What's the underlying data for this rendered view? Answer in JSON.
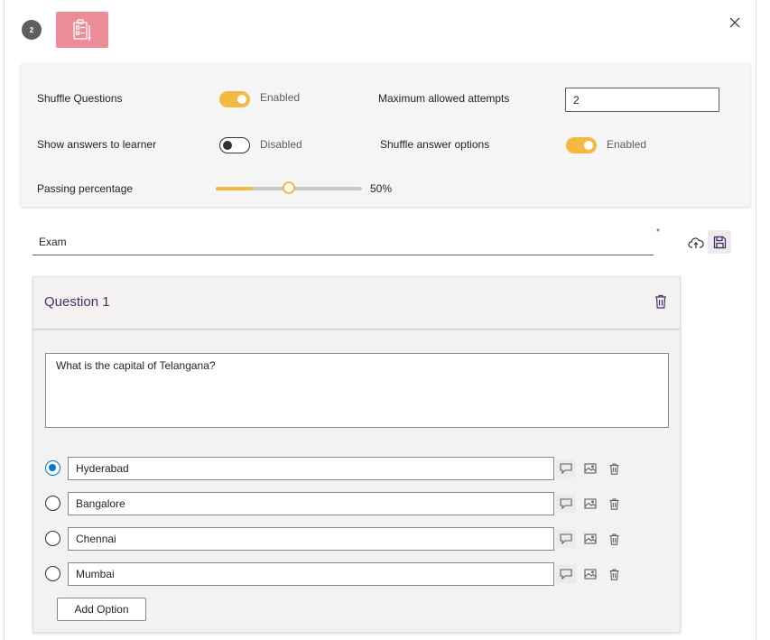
{
  "header": {
    "step_number": "2",
    "icon": "quiz-clipboard-icon",
    "close_icon": "close-icon"
  },
  "settings": {
    "shuffle_questions": {
      "label": "Shuffle Questions",
      "status": "Enabled",
      "enabled": true
    },
    "max_attempts": {
      "label": "Maximum allowed attempts",
      "value": "2"
    },
    "show_answers": {
      "label": "Show answers to learner",
      "status": "Disabled",
      "enabled": false
    },
    "shuffle_options": {
      "label": "Shuffle answer options",
      "status": "Enabled",
      "enabled": true
    },
    "passing": {
      "label": "Passing percentage",
      "value_text": "50%",
      "value": 50
    }
  },
  "quiz": {
    "title_value": "Exam",
    "required_mark": "*",
    "upload_icon": "cloud-upload-icon",
    "save_icon": "save-icon"
  },
  "question": {
    "title": "Question 1",
    "text": "What is the capital of Telangana?",
    "options": [
      {
        "label": "Hyderabad",
        "selected": true
      },
      {
        "label": "Bangalore",
        "selected": false
      },
      {
        "label": "Chennai",
        "selected": false
      },
      {
        "label": "Mumbai",
        "selected": false
      }
    ],
    "add_option_label": "Add Option"
  },
  "colors": {
    "accent_toggle": "#f4b942",
    "radio_selected": "#0078d4",
    "question_title": "#4b2d6b",
    "quiz_icon_bg": "#ec8c98"
  }
}
